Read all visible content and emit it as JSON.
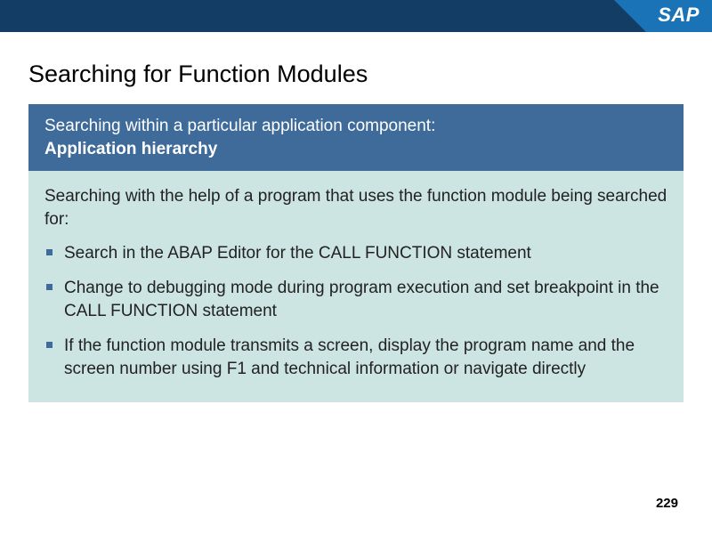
{
  "brand": {
    "logo_text": "SAP"
  },
  "slide": {
    "title": "Searching for Function Modules",
    "panel_header": {
      "line1": "Searching within a particular application component:",
      "line2": "Application hierarchy"
    },
    "panel_body": {
      "lead": "Searching with the help of a program that uses the function module being searched for:",
      "bullets": [
        "Search in the ABAP Editor for the CALL FUNCTION statement",
        "Change to debugging mode during program execution and set breakpoint in the CALL FUNCTION statement",
        "If the function module transmits a screen, display the program name and the screen number using F1 and technical information or navigate directly"
      ]
    },
    "page_number": "229"
  }
}
